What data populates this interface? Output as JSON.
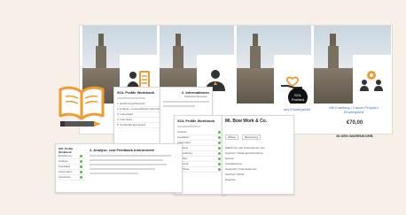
{
  "products": [
    {
      "label": ""
    },
    {
      "label": ""
    },
    {
      "label": "ses Einstiegsbild"
    },
    {
      "label": "Mit Coaching / Career Program Einstiegsbild",
      "price": "€70,00",
      "cta": "IN DEN WARENKORB"
    }
  ],
  "strip_labels": {
    "left": "KORB"
  },
  "soilmed_badge": "SOL ProMed",
  "screen1": {
    "title": "SOL ProMe Workbook",
    "items": [
      "1. Einführung/Übersicht",
      "2. Analyse- und Feedback Instrumente",
      "3. Lebenslauf",
      "4. Interviews",
      "5. Verhandlung/Angebot"
    ]
  },
  "screen2": {
    "heading": "2. Informationen",
    "subtitle": "Workbook Baustein",
    "items": [
      "Analyse",
      "Feedback",
      "Lebenslauf",
      "Interview",
      "Verhandlung",
      "Angebot",
      "Netzwerk",
      "Abschluss"
    ]
  },
  "screen3": {
    "title": "SOL ProMe Workbook",
    "heading": "Mi. Bow Work & Co.",
    "buttons": [
      "Öffnen",
      "Bewertung"
    ],
    "lines": [
      "Wähle hier das Unternehmen aus",
      "Angebot / Stellenausschreibung",
      "Notizen",
      "Kontaktperson",
      "Gespräch / Interviewtermin",
      "Nächster Schritt",
      "Ergebnis"
    ]
  },
  "screen4": {
    "title": "SOL ProMe Workbook",
    "heading": "2. Analyse- und Feedback Instrumente",
    "sidebar": [
      "Einführung",
      "Analyse",
      "Feedback",
      "Lebenslauf",
      "Interviews",
      "Verhandlung",
      "Angebot"
    ]
  },
  "colors": {
    "accent_orange": "#f29a2e",
    "badge_bg": "#111111",
    "price_color": "#222222",
    "link_blue": "#3a7fbf"
  }
}
